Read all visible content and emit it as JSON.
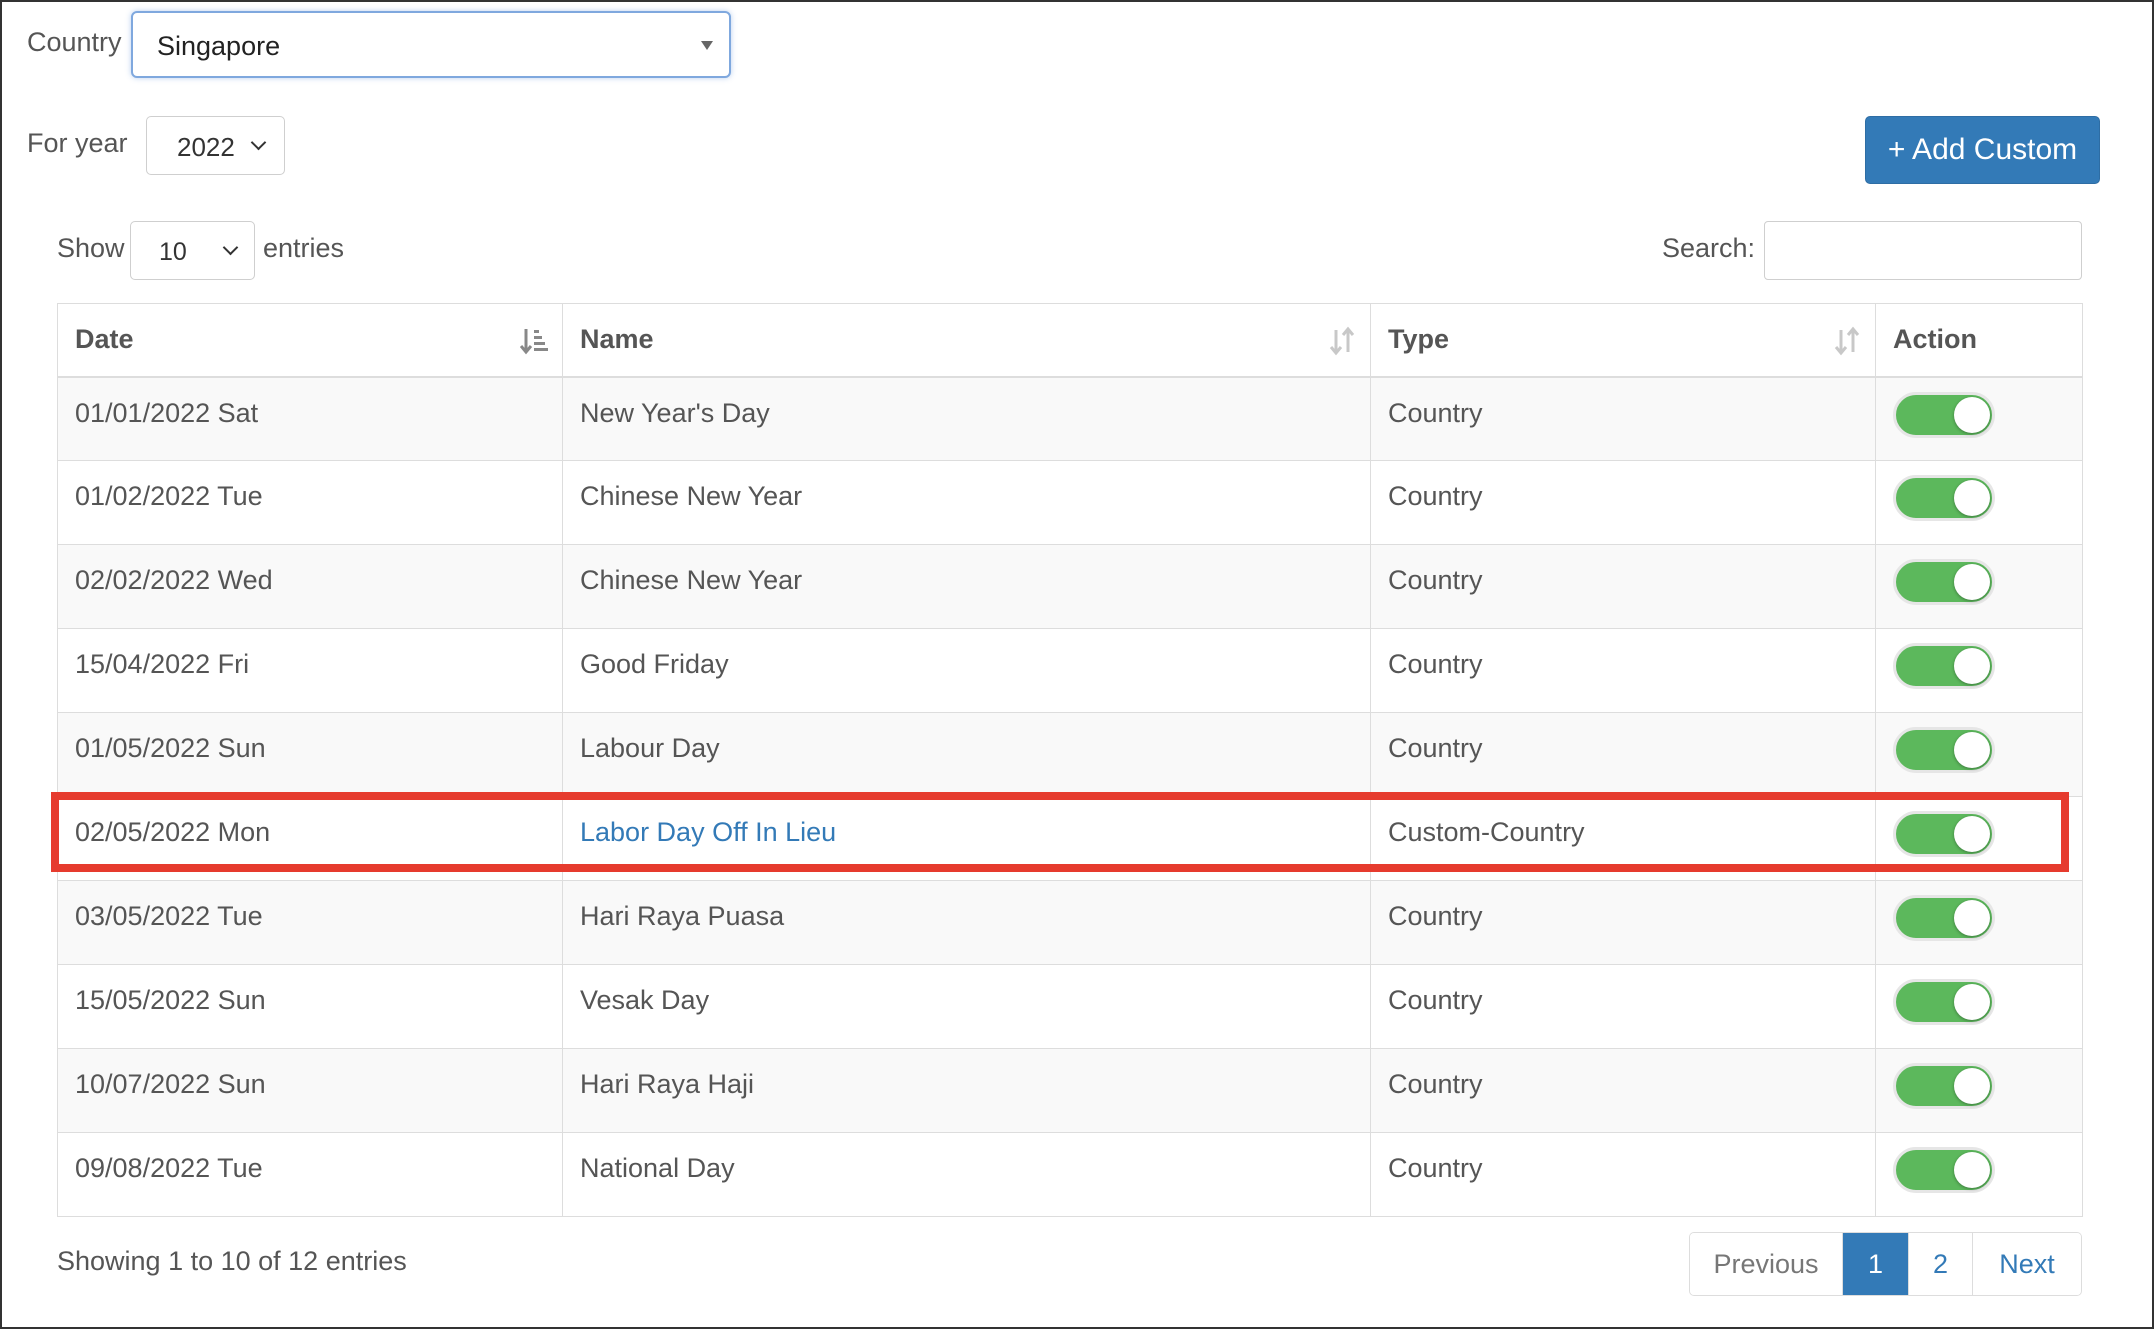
{
  "filters": {
    "country_label": "Country",
    "country_value": "Singapore",
    "year_label": "For year",
    "year_value": "2022",
    "add_button_label": "+ Add Custom"
  },
  "table_controls": {
    "show_label": "Show",
    "page_length": "10",
    "entries_label": "entries",
    "search_label": "Search:",
    "search_value": ""
  },
  "table": {
    "columns": [
      "Date",
      "Name",
      "Type",
      "Action"
    ],
    "rows": [
      {
        "date": "01/01/2022 Sat",
        "name": "New Year's Day",
        "type": "Country",
        "enabled": true
      },
      {
        "date": "01/02/2022 Tue",
        "name": "Chinese New Year",
        "type": "Country",
        "enabled": true
      },
      {
        "date": "02/02/2022 Wed",
        "name": "Chinese New Year",
        "type": "Country",
        "enabled": true
      },
      {
        "date": "15/04/2022 Fri",
        "name": "Good Friday",
        "type": "Country",
        "enabled": true
      },
      {
        "date": "01/05/2022 Sun",
        "name": "Labour Day",
        "type": "Country",
        "enabled": true
      },
      {
        "date": "02/05/2022 Mon",
        "name": "Labor Day Off In Lieu",
        "type": "Custom-Country",
        "enabled": true
      },
      {
        "date": "03/05/2022 Tue",
        "name": "Hari Raya Puasa",
        "type": "Country",
        "enabled": true
      },
      {
        "date": "15/05/2022 Sun",
        "name": "Vesak Day",
        "type": "Country",
        "enabled": true
      },
      {
        "date": "10/07/2022 Sun",
        "name": "Hari Raya Haji",
        "type": "Country",
        "enabled": true
      },
      {
        "date": "09/08/2022 Tue",
        "name": "National Day",
        "type": "Country",
        "enabled": true
      }
    ]
  },
  "footer": {
    "info": "Showing 1 to 10 of 12 entries",
    "pagination": {
      "previous": "Previous",
      "page1": "1",
      "page2": "2",
      "next": "Next"
    }
  },
  "colors": {
    "primary": "#337ab7",
    "toggle_on": "#5cb85c",
    "highlight": "#e63b2e"
  },
  "icons": {
    "date_sort": "sort-ascending-icon",
    "name_sort": "sort-both-icon",
    "type_sort": "sort-both-icon",
    "country_caret": "caret-down-icon",
    "year_chevron": "chevron-down-icon"
  }
}
